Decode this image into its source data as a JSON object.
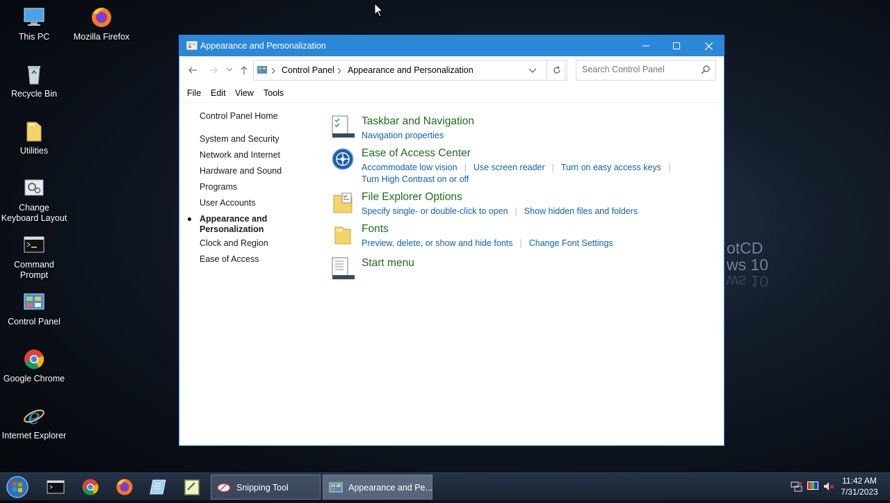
{
  "desktop": {
    "icons": [
      {
        "label": "This PC"
      },
      {
        "label": "Mozilla Firefox"
      },
      {
        "label": "Recycle Bin"
      },
      {
        "label": "Utilities"
      },
      {
        "label": "Change Keyboard Layout"
      },
      {
        "label": "Command Prompt"
      },
      {
        "label": "Control Panel"
      },
      {
        "label": "Google Chrome"
      },
      {
        "label": "Internet Explorer"
      }
    ],
    "watermark": {
      "line1": "otCD",
      "line2": "ws 10",
      "line3": "ws 10"
    }
  },
  "window": {
    "title": "Appearance and Personalization",
    "breadcrumb": [
      "Control Panel",
      "Appearance and Personalization"
    ],
    "search_placeholder": "Search Control Panel",
    "menu": [
      "File",
      "Edit",
      "View",
      "Tools"
    ],
    "sidebar": [
      "Control Panel Home",
      "System and Security",
      "Network and Internet",
      "Hardware and Sound",
      "Programs",
      "User Accounts",
      "Appearance and Personalization",
      "Clock and Region",
      "Ease of Access"
    ],
    "categories": [
      {
        "title": "Taskbar and Navigation",
        "links": [
          "Navigation properties"
        ]
      },
      {
        "title": "Ease of Access Center",
        "links": [
          "Accommodate low vision",
          "Use screen reader",
          "Turn on easy access keys"
        ],
        "links2": [
          "Turn High Contrast on or off"
        ]
      },
      {
        "title": "File Explorer Options",
        "links": [
          "Specify single- or double-click to open",
          "Show hidden files and folders"
        ]
      },
      {
        "title": "Fonts",
        "links": [
          "Preview, delete, or show and hide fonts",
          "Change Font Settings"
        ]
      },
      {
        "title": "Start menu",
        "links": []
      }
    ]
  },
  "taskbar": {
    "tasks": [
      {
        "label": "Snipping Tool"
      },
      {
        "label": "Appearance and Pe..."
      }
    ],
    "clock": {
      "time": "11:42 AM",
      "date": "7/31/2023"
    }
  },
  "colors": {
    "accent": "#2b88d8",
    "link": "#0b62b5",
    "category": "#1e6b1e"
  }
}
